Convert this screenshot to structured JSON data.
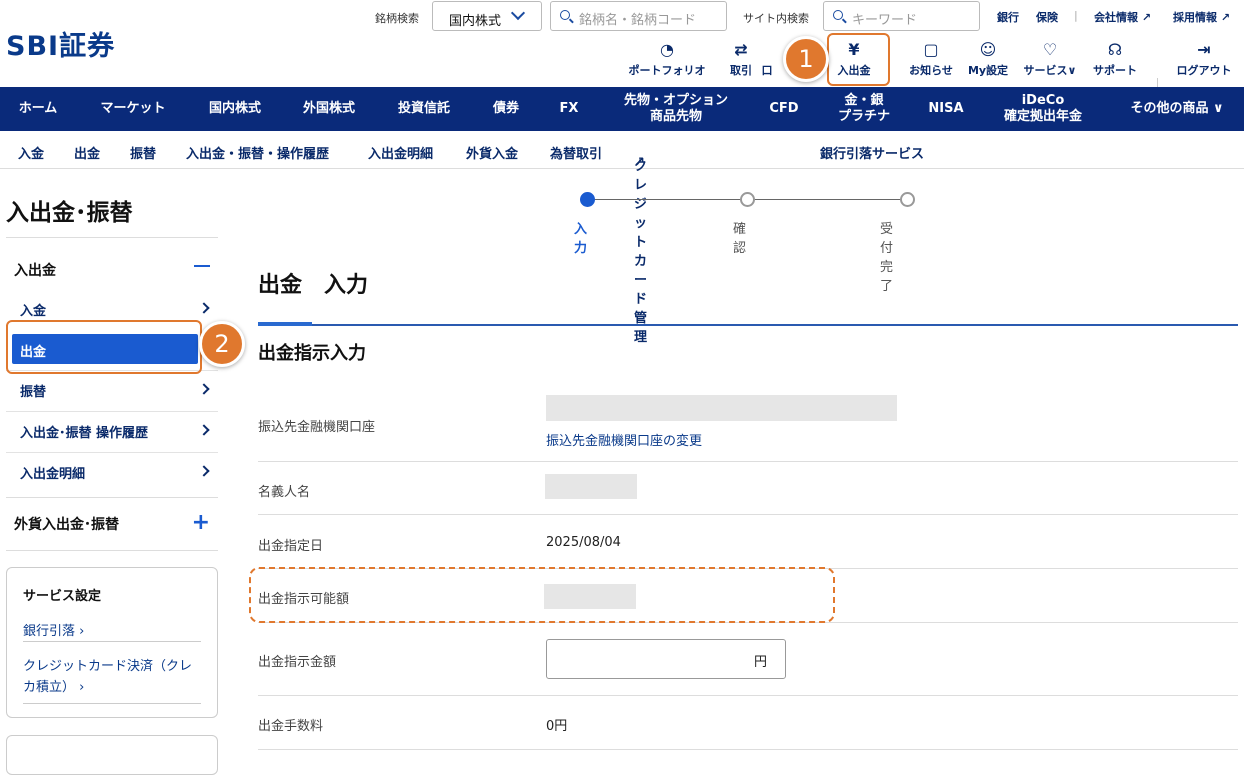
{
  "logo": "SBI証券",
  "search": {
    "label": "銘柄検索",
    "market": "国内株式",
    "placeholder": "銘柄名・銘柄コード",
    "site_label": "サイト内検索",
    "site_placeholder": "キーワード"
  },
  "toplinks": [
    "銀行",
    "保険",
    "|",
    "会社情報",
    "採用情報"
  ],
  "icons": [
    {
      "label": "ポートフォリオ",
      "glyph": "◔"
    },
    {
      "label": "取引",
      "glyph": "⇄"
    },
    {
      "label": "口",
      "glyph": ""
    },
    {
      "label": "入出金",
      "glyph": "¥"
    },
    {
      "label": "お知らせ",
      "glyph": "▢"
    },
    {
      "label": "My設定",
      "glyph": "☺"
    },
    {
      "label": "サービス",
      "glyph": "♡"
    },
    {
      "label": "サポート",
      "glyph": "☊"
    },
    {
      "label": "ログアウト",
      "glyph": "⇥"
    }
  ],
  "nav": [
    "ホーム",
    "マーケット",
    "国内株式",
    "外国株式",
    "投資信託",
    "債券",
    "FX",
    "先物・オプション\n商品先物",
    "CFD",
    "金・銀\nプラチナ",
    "NISA",
    "iDeCo\n確定拠出年金",
    "その他の商品"
  ],
  "subnav": [
    "入金",
    "出金",
    "振替",
    "入出金・振替・操作履歴",
    "入出金明細",
    "外貨入金",
    "為替取引",
    "クレジットカード管理",
    "銀行引落サービス"
  ],
  "sidebar": {
    "page_title": "入出金･振替",
    "group1": "入出金",
    "items": [
      "入金",
      "出金",
      "振替",
      "入出金･振替 操作履歴",
      "入出金明細"
    ],
    "group2": "外貨入出金･振替",
    "card_title": "サービス設定",
    "card_link1": "銀行引落",
    "card_link2": "クレジットカード決済（クレカ積立）"
  },
  "steps": [
    "入力",
    "確認",
    "受付完了"
  ],
  "main": {
    "title": "出金　入力",
    "section": "出金指示入力",
    "rows": [
      {
        "label": "振込先金融機関口座",
        "link": "振込先金融機関口座の変更"
      },
      {
        "label": "名義人名"
      },
      {
        "label": "出金指定日",
        "value": "2025/08/04"
      },
      {
        "label": "出金指示可能額"
      },
      {
        "label": "出金指示金額",
        "unit": "円"
      },
      {
        "label": "出金手数料",
        "value": "0円"
      }
    ]
  },
  "annotations": {
    "badge1": "1",
    "badge2": "2",
    "accent": "#e0782e"
  }
}
